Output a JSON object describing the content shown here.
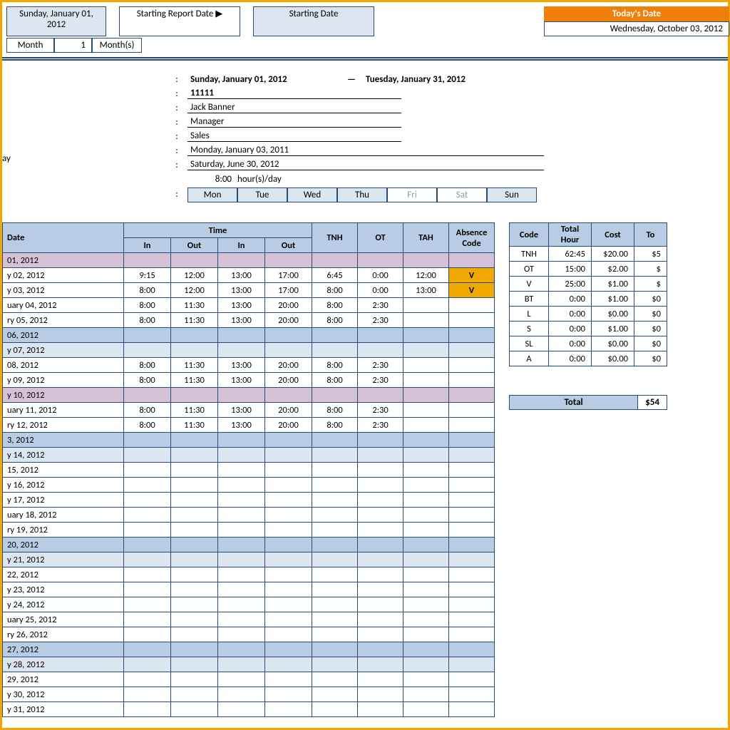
{
  "top": {
    "report_start_full": "Sunday, January 01, 2012",
    "starting_report_date_label": "Starting Report Date ▶",
    "starting_date_label": "Starting Date",
    "todays_date_label": "Today's Date",
    "todays_date_value": "Wednesday, October 03, 2012",
    "month_label": "Month",
    "month_value": "1",
    "months_label": "Month(s)"
  },
  "info": {
    "period_start": "Sunday, January 01, 2012",
    "period_end": "Tuesday, January 31, 2012",
    "employee_id": "11111",
    "name": "Jack Banner",
    "title": "Manager",
    "department": "Sales",
    "hire_date": "Monday, January 03, 2011",
    "end_date": "Saturday, June 30, 2012",
    "hours_value": "8:00",
    "hours_unit": "hour(s)/day",
    "days": [
      "Mon",
      "Tue",
      "Wed",
      "Thu",
      "Fri",
      "Sat",
      "Sun"
    ],
    "off_days": [
      "Fri",
      "Sat"
    ]
  },
  "left_label": "ay",
  "headers": {
    "date": "Date",
    "time": "Time",
    "in": "In",
    "out": "Out",
    "tnh": "TNH",
    "ot": "OT",
    "tah": "TAH",
    "absence": "Absence\nCode"
  },
  "rows": [
    {
      "date": "01, 2012",
      "cls": "row-pink"
    },
    {
      "date": "y 02, 2012",
      "in1": "9:15",
      "out1": "12:00",
      "in2": "13:00",
      "out2": "17:00",
      "tnh": "6:45",
      "ot": "0:00",
      "tah": "12:00",
      "abs": "V"
    },
    {
      "date": "y 03, 2012",
      "in1": "8:00",
      "out1": "12:00",
      "in2": "13:00",
      "out2": "17:00",
      "tnh": "8:00",
      "ot": "0:00",
      "tah": "13:00",
      "abs": "V"
    },
    {
      "date": "uary 04, 2012",
      "in1": "8:00",
      "out1": "11:30",
      "in2": "13:00",
      "out2": "20:00",
      "tnh": "8:00",
      "ot": "2:30"
    },
    {
      "date": "ry 05, 2012",
      "in1": "8:00",
      "out1": "11:30",
      "in2": "13:00",
      "out2": "20:00",
      "tnh": "8:00",
      "ot": "2:30"
    },
    {
      "date": "06, 2012",
      "cls": "row-blue"
    },
    {
      "date": "y 07, 2012",
      "cls": "row-blue2"
    },
    {
      "date": " 08, 2012",
      "in1": "8:00",
      "out1": "11:30",
      "in2": "13:00",
      "out2": "20:00",
      "tnh": "8:00",
      "ot": "2:30"
    },
    {
      "date": "y 09, 2012",
      "in1": "8:00",
      "out1": "11:30",
      "in2": "13:00",
      "out2": "20:00",
      "tnh": "8:00",
      "ot": "2:30"
    },
    {
      "date": "y 10, 2012",
      "cls": "row-pink"
    },
    {
      "date": "uary 11, 2012",
      "in1": "8:00",
      "out1": "11:30",
      "in2": "13:00",
      "out2": "20:00",
      "tnh": "8:00",
      "ot": "2:30"
    },
    {
      "date": "ry 12, 2012",
      "in1": "8:00",
      "out1": "11:30",
      "in2": "13:00",
      "out2": "20:00",
      "tnh": "8:00",
      "ot": "2:30"
    },
    {
      "date": "3, 2012",
      "cls": "row-blue"
    },
    {
      "date": "y 14, 2012",
      "cls": "row-blue2"
    },
    {
      "date": " 15, 2012"
    },
    {
      "date": "y 16, 2012"
    },
    {
      "date": "y 17, 2012"
    },
    {
      "date": "uary 18, 2012"
    },
    {
      "date": "ry 19, 2012"
    },
    {
      "date": "20, 2012",
      "cls": "row-blue"
    },
    {
      "date": "y 21, 2012",
      "cls": "row-blue2"
    },
    {
      "date": " 22, 2012"
    },
    {
      "date": "y 23, 2012"
    },
    {
      "date": "y 24, 2012"
    },
    {
      "date": "uary 25, 2012"
    },
    {
      "date": "ry 26, 2012"
    },
    {
      "date": "27, 2012",
      "cls": "row-blue"
    },
    {
      "date": "y 28, 2012",
      "cls": "row-blue2"
    },
    {
      "date": " 29, 2012"
    },
    {
      "date": "y 30, 2012"
    },
    {
      "date": "y 31, 2012"
    }
  ],
  "summary": {
    "headers": {
      "code": "Code",
      "total_hour": "Total\nHour",
      "cost": "Cost",
      "to": "To"
    },
    "rows": [
      {
        "code": "TNH",
        "hours": "62:45",
        "cost": "$20.00",
        "to": "$5"
      },
      {
        "code": "OT",
        "hours": "15:00",
        "cost": "$2.00",
        "to": "$"
      },
      {
        "code": "V",
        "hours": "25:00",
        "cost": "$1.00",
        "to": "$"
      },
      {
        "code": "BT",
        "hours": "0:00",
        "cost": "$1.00",
        "to": "$0"
      },
      {
        "code": "L",
        "hours": "0:00",
        "cost": "$0.00",
        "to": "$0"
      },
      {
        "code": "S",
        "hours": "0:00",
        "cost": "$1.00",
        "to": "$0"
      },
      {
        "code": "SL",
        "hours": "0:00",
        "cost": "$0.00",
        "to": "$0"
      },
      {
        "code": "A",
        "hours": "0:00",
        "cost": "$0.00",
        "to": "$0"
      }
    ],
    "total_label": "Total",
    "total_value": "$54"
  }
}
